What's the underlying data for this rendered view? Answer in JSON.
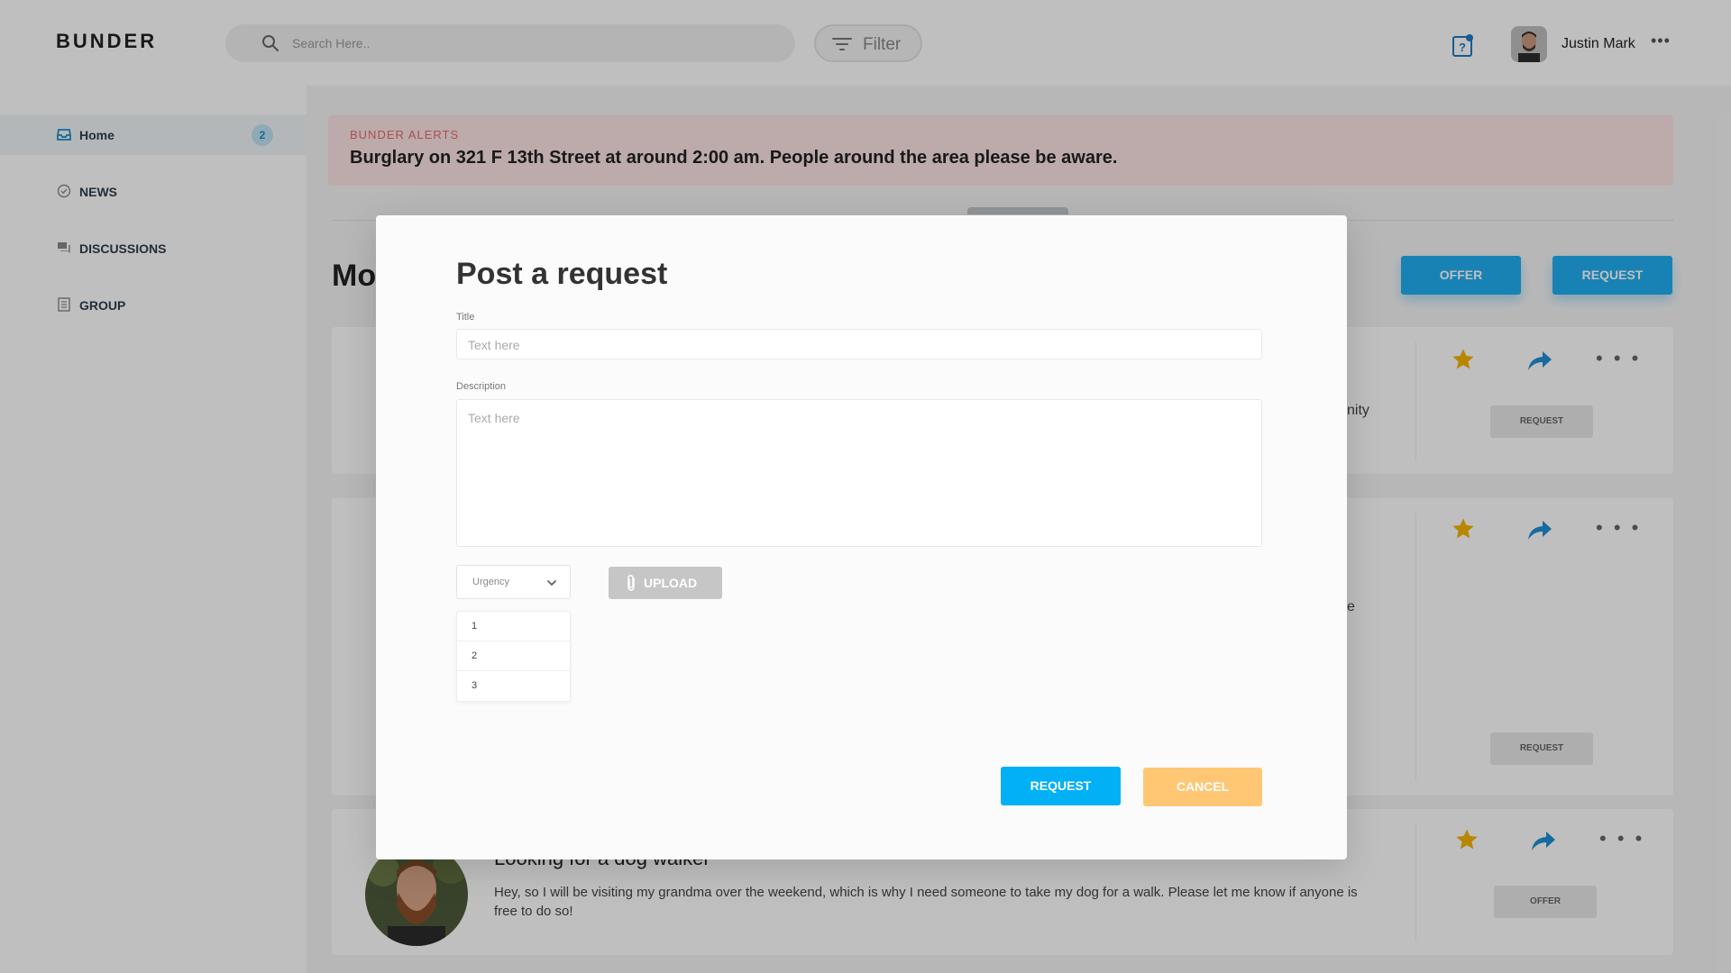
{
  "app": {
    "name": "BUNDER"
  },
  "header": {
    "search_placeholder": "Search Here..",
    "filter_label": "Filter",
    "user_name": "Justin Mark",
    "more_label": "•••"
  },
  "sidebar": {
    "items": [
      {
        "label": "Home",
        "icon": "inbox-icon",
        "badge": "2",
        "active": true
      },
      {
        "label": "NEWS",
        "icon": "check-circle-icon"
      },
      {
        "label": "DISCUSSIONS",
        "icon": "chat-icon"
      },
      {
        "label": "GROUP",
        "icon": "document-icon"
      }
    ]
  },
  "alert": {
    "heading": "BUNDER ALERTS",
    "text": "Burglary on 321 F 13th Street at around 2:00 am. People around the area please be aware."
  },
  "main": {
    "section_title_partial": "Mo",
    "offer_button": "OFFER",
    "request_button": "REQUEST",
    "cards": [
      {
        "tag": "REQUEST",
        "peek_text": "nity"
      },
      {
        "tag": "REQUEST",
        "peek_text": "e"
      },
      {
        "tag": "OFFER",
        "title": "Looking for a dog walker",
        "description": "Hey, so I will be visiting my grandma over the weekend, which is why I need someone to take my dog for a walk. Please let me know if anyone is free to do so!"
      }
    ],
    "dots_label": "• • •"
  },
  "modal": {
    "title": "Post a request",
    "title_field": {
      "label": "Title",
      "placeholder": "Text here"
    },
    "description_field": {
      "label": "Description",
      "placeholder": "Text here"
    },
    "urgency": {
      "label": "Urgency",
      "options": [
        "1",
        "2",
        "3"
      ]
    },
    "upload_label": "UPLOAD",
    "request_button": "REQUEST",
    "cancel_button": "CANCEL"
  },
  "colors": {
    "primary": "#22aef1",
    "cancel": "#ffc773",
    "alert_bg": "#fde3e3",
    "alert_heading": "#e56b6b",
    "star": "#f5b400",
    "share": "#1f8fd6"
  }
}
